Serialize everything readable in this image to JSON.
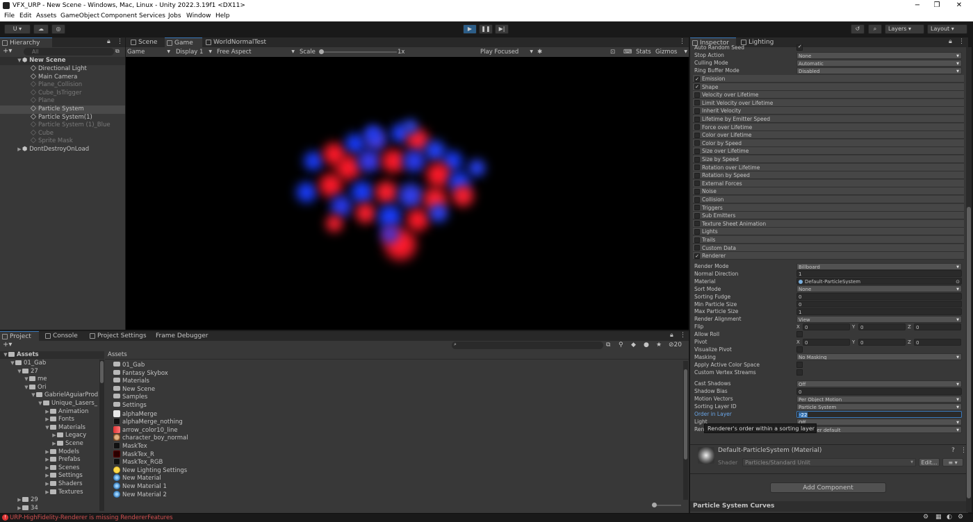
{
  "title_bar": {
    "title": "VFX_URP - New Scene - Windows, Mac, Linux - Unity 2022.3.19f1 <DX11>",
    "minimize": "−",
    "maximize": "❐",
    "close": "✕"
  },
  "menu": [
    "File",
    "Edit",
    "Assets",
    "GameObject",
    "Component",
    "Services",
    "Jobs",
    "Window",
    "Help"
  ],
  "toolbar": {
    "account": "U ▾",
    "layers": "Layers",
    "layout": "Layout"
  },
  "hierarchy": {
    "tab": "Hierarchy",
    "search_placeholder": "All",
    "scene": "New Scene",
    "items": [
      {
        "label": "Directional Light",
        "dim": false
      },
      {
        "label": "Main Camera",
        "dim": false
      },
      {
        "label": "Plane_Collision",
        "dim": true
      },
      {
        "label": "Cube_IsTrigger",
        "dim": true
      },
      {
        "label": "Plane",
        "dim": true
      },
      {
        "label": "Particle System",
        "dim": false
      },
      {
        "label": "Particle System(1)",
        "dim": false
      },
      {
        "label": "Particle System (1)_Blue",
        "dim": true
      },
      {
        "label": "Cube",
        "dim": true
      },
      {
        "label": "Sprite Mask",
        "dim": true
      }
    ],
    "dont_destroy": "DontDestroyOnLoad"
  },
  "scene_tabs": {
    "scene": "Scene",
    "game": "Game",
    "world": "WorldNormalTest"
  },
  "game_bar": {
    "mode": "Game",
    "display": "Display 1",
    "aspect": "Free Aspect",
    "scale_label": "Scale",
    "scale_value": "1x",
    "play_focused": "Play Focused",
    "stats": "Stats",
    "gizmos": "Gizmos"
  },
  "bottom_tabs": {
    "project": "Project",
    "console": "Console",
    "settings": "Project Settings",
    "frame": "Frame Debugger"
  },
  "project": {
    "count": "20",
    "tree_root": "Assets",
    "tree": [
      {
        "label": "01_Gab",
        "indent": 1
      },
      {
        "label": "27",
        "indent": 2
      },
      {
        "label": "me",
        "indent": 3
      },
      {
        "label": "Ori",
        "indent": 3
      },
      {
        "label": "GabrielAguiarProd",
        "indent": 4
      },
      {
        "label": "Unique_Lasers_",
        "indent": 5
      },
      {
        "label": "Animation",
        "indent": 6
      },
      {
        "label": "Fonts",
        "indent": 6
      },
      {
        "label": "Materials",
        "indent": 6
      },
      {
        "label": "Legacy",
        "indent": 7
      },
      {
        "label": "Scene",
        "indent": 7
      },
      {
        "label": "Models",
        "indent": 6
      },
      {
        "label": "Prefabs",
        "indent": 6
      },
      {
        "label": "Scenes",
        "indent": 6
      },
      {
        "label": "Settings",
        "indent": 6
      },
      {
        "label": "Shaders",
        "indent": 6
      },
      {
        "label": "Textures",
        "indent": 6
      },
      {
        "label": "29",
        "indent": 2
      },
      {
        "label": "34",
        "indent": 2
      }
    ],
    "breadcrumb": "Assets",
    "list": [
      {
        "label": "01_Gab",
        "kind": "folder"
      },
      {
        "label": "Fantasy Skybox",
        "kind": "folder"
      },
      {
        "label": "Materials",
        "kind": "folder"
      },
      {
        "label": "New Scene",
        "kind": "folder"
      },
      {
        "label": "Samples",
        "kind": "folder"
      },
      {
        "label": "Settings",
        "kind": "folder"
      },
      {
        "label": "alphaMerge",
        "kind": "white"
      },
      {
        "label": "alphaMerge_nothing",
        "kind": "dark"
      },
      {
        "label": "arrow_color10_line",
        "kind": "arrow"
      },
      {
        "label": "character_boy_normal",
        "kind": "char"
      },
      {
        "label": "MaskTex",
        "kind": "dark"
      },
      {
        "label": "MaskTex_R",
        "kind": "red"
      },
      {
        "label": "MaskTex_RGB",
        "kind": "dark"
      },
      {
        "label": "New Lighting Settings",
        "kind": "light"
      },
      {
        "label": "New Material",
        "kind": "mat"
      },
      {
        "label": "New Material 1",
        "kind": "mat"
      },
      {
        "label": "New Material 2",
        "kind": "mat"
      }
    ]
  },
  "inspector": {
    "tab": "Inspector",
    "lighting_tab": "Lighting",
    "top_rows": [
      {
        "label": "Auto Random Seed",
        "value": "✓",
        "type": "check"
      },
      {
        "label": "Stop Action",
        "value": "None",
        "type": "dd"
      },
      {
        "label": "Culling Mode",
        "value": "Automatic",
        "type": "dd"
      },
      {
        "label": "Ring Buffer Mode",
        "value": "Disabled",
        "type": "dd"
      }
    ],
    "modules": [
      {
        "label": "Emission",
        "checked": true
      },
      {
        "label": "Shape",
        "checked": true
      },
      {
        "label": "Velocity over Lifetime",
        "checked": false
      },
      {
        "label": "Limit Velocity over Lifetime",
        "checked": false
      },
      {
        "label": "Inherit Velocity",
        "checked": false
      },
      {
        "label": "Lifetime by Emitter Speed",
        "checked": false
      },
      {
        "label": "Force over Lifetime",
        "checked": false
      },
      {
        "label": "Color over Lifetime",
        "checked": false
      },
      {
        "label": "Color by Speed",
        "checked": false
      },
      {
        "label": "Size over Lifetime",
        "checked": false
      },
      {
        "label": "Size by Speed",
        "checked": false
      },
      {
        "label": "Rotation over Lifetime",
        "checked": false
      },
      {
        "label": "Rotation by Speed",
        "checked": false
      },
      {
        "label": "External Forces",
        "checked": false
      },
      {
        "label": "Noise",
        "checked": false
      },
      {
        "label": "Collision",
        "checked": false
      },
      {
        "label": "Triggers",
        "checked": false
      },
      {
        "label": "Sub Emitters",
        "checked": false
      },
      {
        "label": "Texture Sheet Animation",
        "checked": false
      },
      {
        "label": "Lights",
        "checked": false
      },
      {
        "label": "Trails",
        "checked": false
      },
      {
        "label": "Custom Data",
        "checked": false
      },
      {
        "label": "Renderer",
        "checked": true
      }
    ],
    "renderer": [
      {
        "label": "Render Mode",
        "value": "Billboard",
        "type": "dd"
      },
      {
        "label": "Normal Direction",
        "value": "1",
        "type": "field"
      },
      {
        "label": "Material",
        "value": "Default-ParticleSystem",
        "type": "obj"
      },
      {
        "label": "Sort Mode",
        "value": "None",
        "type": "dd"
      },
      {
        "label": "Sorting Fudge",
        "value": "0",
        "type": "field"
      },
      {
        "label": "Min Particle Size",
        "value": "0",
        "type": "field"
      },
      {
        "label": "Max Particle Size",
        "value": "1",
        "type": "field"
      },
      {
        "label": "Render Alignment",
        "value": "View",
        "type": "dd"
      },
      {
        "label": "Flip",
        "value": "",
        "type": "xyz"
      },
      {
        "label": "Allow Roll",
        "value": "",
        "type": "check"
      },
      {
        "label": "Pivot",
        "value": "",
        "type": "xyz"
      },
      {
        "label": "Visualize Pivot",
        "value": "",
        "type": "check"
      },
      {
        "label": "Masking",
        "value": "No Masking",
        "type": "dd"
      },
      {
        "label": "Apply Active Color Space",
        "value": "",
        "type": "check"
      },
      {
        "label": "Custom Vertex Streams",
        "value": "",
        "type": "check"
      }
    ],
    "renderer2": [
      {
        "label": "Cast Shadows",
        "value": "Off",
        "type": "dd"
      },
      {
        "label": "Shadow Bias",
        "value": "0",
        "type": "field"
      },
      {
        "label": "Motion Vectors",
        "value": "Per Object Motion",
        "type": "dd"
      },
      {
        "label": "Sorting Layer ID",
        "value": "Particle System",
        "type": "dd"
      },
      {
        "label": "Order in Layer",
        "value": "-22",
        "type": "active"
      }
    ],
    "xyz": {
      "x": "X",
      "y": "Y",
      "z": "Z",
      "v": "0"
    },
    "tooltip": "Renderer's order within a sorting layer",
    "hidden_rows": {
      "a_label": "Light",
      "a_value": "Off",
      "b_label": "Ren",
      "b_value": "ayer default"
    },
    "material_title": "Default-ParticleSystem (Material)",
    "shader_label": "Shader",
    "shader_value": "Particles/Standard Unlit",
    "edit": "Edit...",
    "add_component": "Add Component",
    "curves": "Particle System Curves"
  },
  "status": {
    "error": "URP-HighFidelity-Renderer is missing RendererFeatures"
  }
}
